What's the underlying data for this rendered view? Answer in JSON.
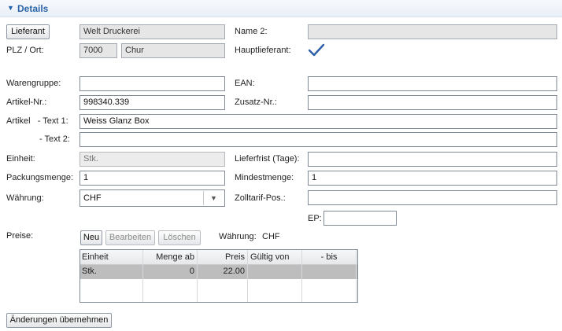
{
  "section": {
    "title": "Details"
  },
  "supplier": {
    "button_label": "Lieferant",
    "name": "Welt Druckerei",
    "name2_label": "Name 2:",
    "name2_value": "",
    "zip_city_label": "PLZ / Ort:",
    "zip": "7000",
    "city": "Chur",
    "main_supplier_label": "Hauptlieferant:",
    "main_supplier_checked": true
  },
  "fields": {
    "warengruppe_label": "Warengruppe:",
    "warengruppe_value": "",
    "ean_label": "EAN:",
    "ean_value": "",
    "artikelnr_label": "Artikel-Nr.:",
    "artikelnr_value": "998340.339",
    "zusatznr_label": "Zusatz-Nr.:",
    "zusatznr_value": "",
    "text1_label": "Artikel   - Text 1:",
    "text1_value": "Weiss Glanz Box",
    "text2_label": "- Text 2:",
    "text2_value": "",
    "einheit_label": "Einheit:",
    "einheit_value": "Stk.",
    "lieferfrist_label": "Lieferfrist (Tage):",
    "lieferfrist_value": "",
    "packungsmenge_label": "Packungsmenge:",
    "packungsmenge_value": "1",
    "mindestmenge_label": "Mindestmenge:",
    "mindestmenge_value": "1",
    "waehrung_label": "Währung:",
    "waehrung_value": "CHF",
    "zolltarif_label": "Zolltarif-Pos.:",
    "zolltarif_value": "",
    "ep_label": "EP:",
    "ep_value": ""
  },
  "prices": {
    "label": "Preise:",
    "new_label": "Neu",
    "edit_label": "Bearbeiten",
    "delete_label": "Löschen",
    "currency_label": "Währung:",
    "currency_value": "CHF",
    "columns": [
      "Einheit",
      "Menge ab",
      "Preis",
      "Gültig von",
      "- bis"
    ],
    "rows": [
      {
        "einheit": "Stk.",
        "menge_ab": "0",
        "preis": "22.00",
        "gueltig_von": "",
        "bis": ""
      }
    ]
  },
  "footer": {
    "apply_label": "Änderungen übernehmen"
  },
  "colors": {
    "accent": "#2a64a8",
    "check": "#2c5ea8"
  }
}
